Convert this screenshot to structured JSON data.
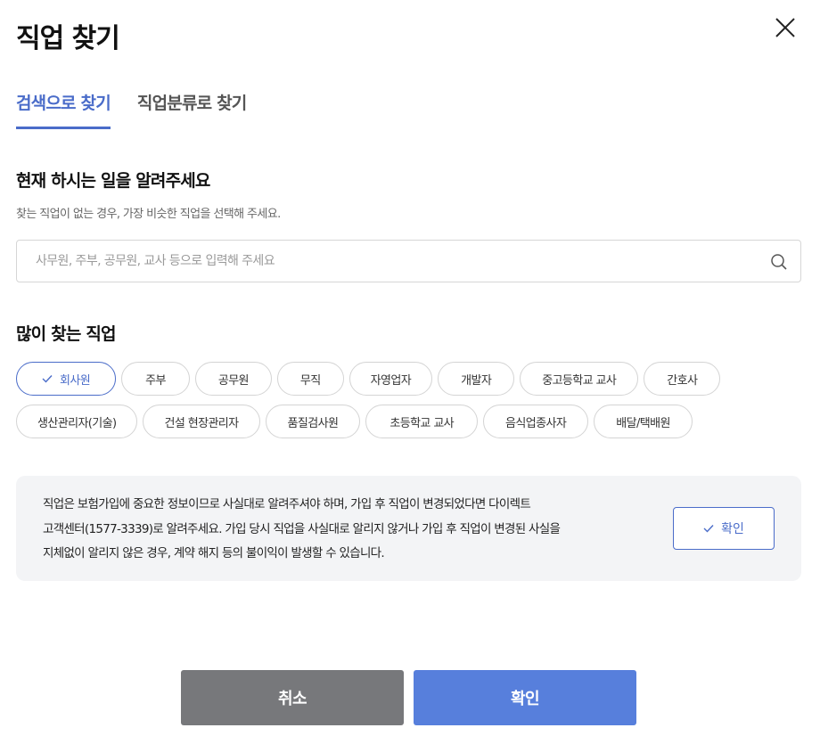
{
  "header": {
    "title": "직업 찾기",
    "close_icon": "close-icon"
  },
  "tabs": [
    {
      "label": "검색으로 찾기",
      "active": true
    },
    {
      "label": "직업분류로 찾기",
      "active": false
    }
  ],
  "question": {
    "title": "현재 하시는 일을 알려주세요",
    "hint": "찾는 직업이 없는 경우, 가장 비슷한 직업을 선택해 주세요."
  },
  "search": {
    "value": "",
    "placeholder": "사무원, 주부, 공무원, 교사 등으로 입력해 주세요",
    "icon": "search-icon"
  },
  "popular": {
    "title": "많이 찾는 직업",
    "selected": "회사원",
    "items": [
      "회사원",
      "주부",
      "공무원",
      "무직",
      "자영업자",
      "개발자",
      "중고등학교 교사",
      "간호사",
      "생산관리자(기술)",
      "건설 현장관리자",
      "품질검사원",
      "초등학교 교사",
      "음식업종사자",
      "배달/택배원"
    ]
  },
  "notice": {
    "line1": "직업은 보험가입에 중요한 정보이므로 사실대로 알려주셔야 하며, 가입 후 직업이 변경되었다면 다이렉트",
    "line2": "고객센터(1577-3339)로 알려주세요. 가입 당시 직업을 사실대로 알리지 않거나 가입 후 직업이 변경된 사실을",
    "line3": "지체없이 알리지 않은 경우, 계약 해지 등의 불이익이 발생할 수 있습니다.",
    "confirm_label": "확인"
  },
  "footer": {
    "cancel_label": "취소",
    "ok_label": "확인"
  },
  "colors": {
    "accent": "#4a6cc9",
    "ok_button": "#577fdc",
    "cancel_button": "#77787b",
    "notice_bg": "#f3f4f6"
  }
}
